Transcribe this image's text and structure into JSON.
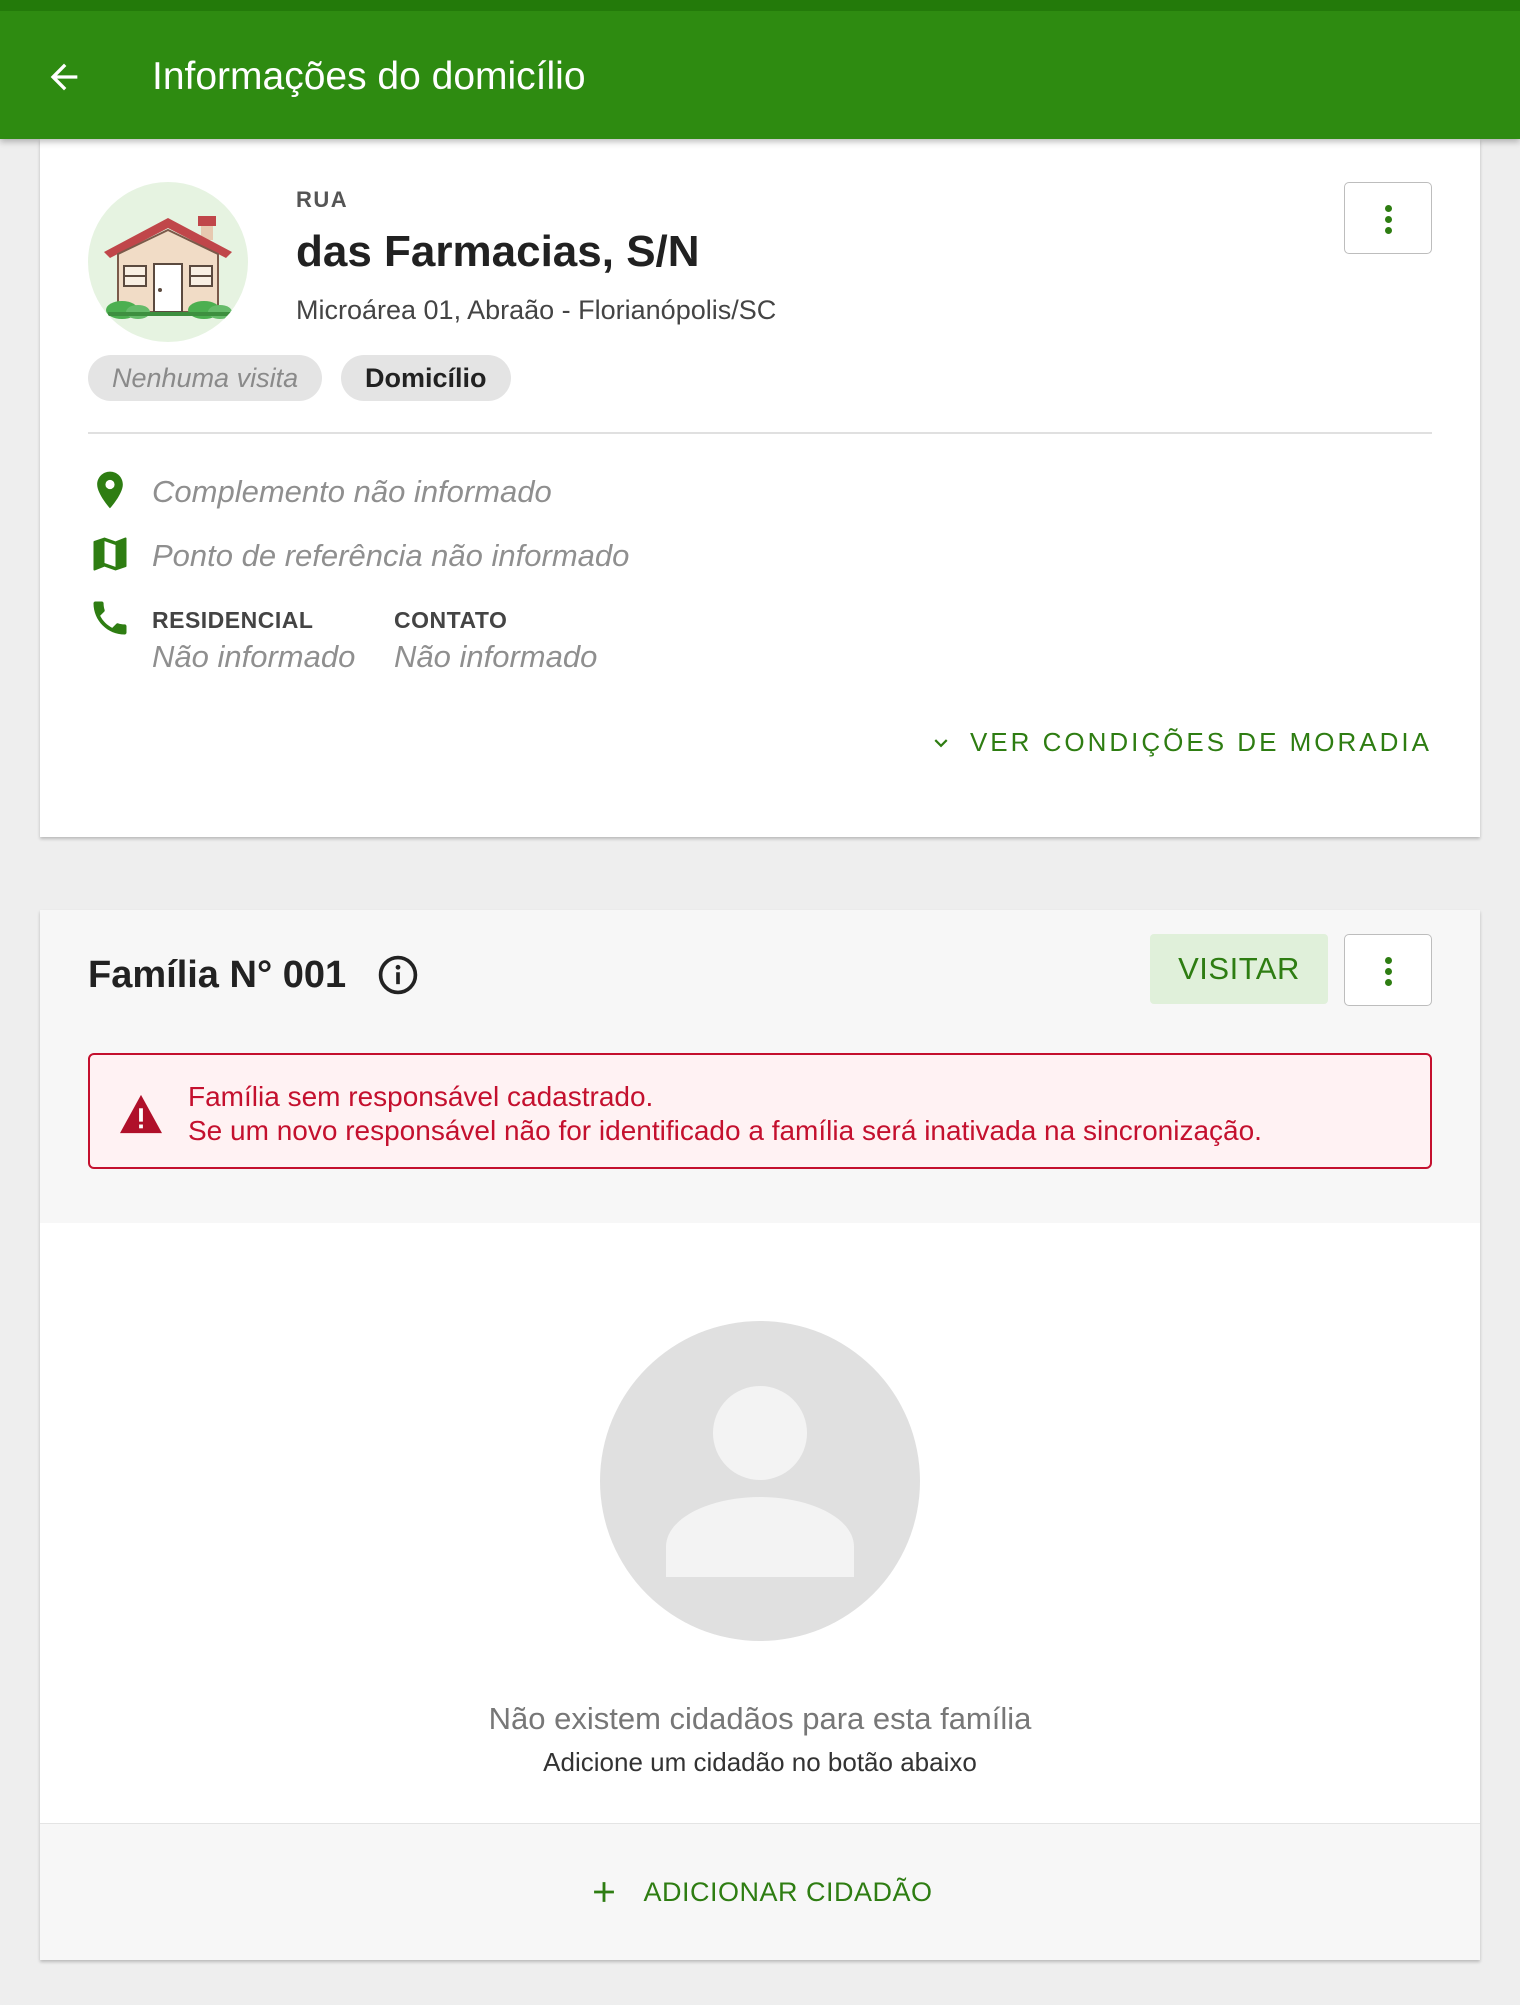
{
  "appbar": {
    "title": "Informações do domicílio"
  },
  "address": {
    "type": "RUA",
    "main": "das Farmacias, S/N",
    "sub": "Microárea 01, Abraão - Florianópolis/SC",
    "chips": [
      "Nenhuma visita",
      "Domicílio"
    ],
    "complemento": "Complemento não informado",
    "referencia": "Ponto de referência não informado",
    "phones": [
      {
        "label": "RESIDENCIAL",
        "value": "Não informado"
      },
      {
        "label": "CONTATO",
        "value": "Não informado"
      }
    ],
    "ver_condicoes": "VER CONDIÇÕES DE MORADIA"
  },
  "family": {
    "title": "Família N° 001",
    "visit_label": "VISITAR",
    "alert_line1": "Família sem responsável cadastrado.",
    "alert_line2": "Se um novo responsável não for identificado a família será inativada na sincronização.",
    "empty_title": "Não existem cidadãos para esta família",
    "empty_sub": "Adicione um cidadão no botão abaixo",
    "add_label": "ADICIONAR CIDADÃO"
  },
  "colors": {
    "primary": "#2e8b11",
    "accent_text": "#2e7d12",
    "danger": "#c4102e"
  }
}
